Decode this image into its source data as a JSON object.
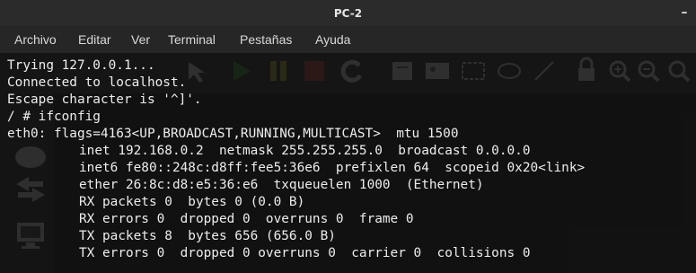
{
  "window": {
    "title": "PC-2",
    "minimize_glyph": "–"
  },
  "menu": {
    "items": [
      "Archivo",
      "Editar",
      "Ver",
      "Terminal",
      "Pestañas",
      "Ayuda"
    ]
  },
  "terminal": {
    "lines": [
      "Trying 127.0.0.1...",
      "Connected to localhost.",
      "Escape character is '^]'.",
      "/ # ifconfig",
      "eth0: flags=4163<UP,BROADCAST,RUNNING,MULTICAST>  mtu 1500",
      "inet 192.168.0.2  netmask 255.255.255.0  broadcast 0.0.0.0",
      "inet6 fe80::248c:d8ff:fee5:36e6  prefixlen 64  scopeid 0x20<link>",
      "ether 26:8c:d8:e5:36:e6  txqueuelen 1000  (Ethernet)",
      "RX packets 0  bytes 0 (0.0 B)",
      "RX errors 0  dropped 0  overruns 0  frame 0",
      "TX packets 8  bytes 656 (656.0 B)",
      "TX errors 0  dropped 0 overruns 0  carrier 0  collisions 0"
    ]
  },
  "background_app": {
    "toolbar_icons": [
      "select-arrow-icon",
      "play-icon",
      "pause-icon",
      "stop-icon",
      "reload-icon",
      "note-icon",
      "picture-icon",
      "rectangle-icon",
      "ellipse-icon",
      "line-icon",
      "lock-icon",
      "zoom-in-icon",
      "zoom-out-icon",
      "zoom-reset-icon"
    ],
    "sidebar_icons": [
      "router-icon",
      "switch-icon",
      "host-icon"
    ],
    "colors": {
      "play": "#2f8f2f",
      "pause": "#b7a72a",
      "stop": "#b5312c"
    }
  }
}
